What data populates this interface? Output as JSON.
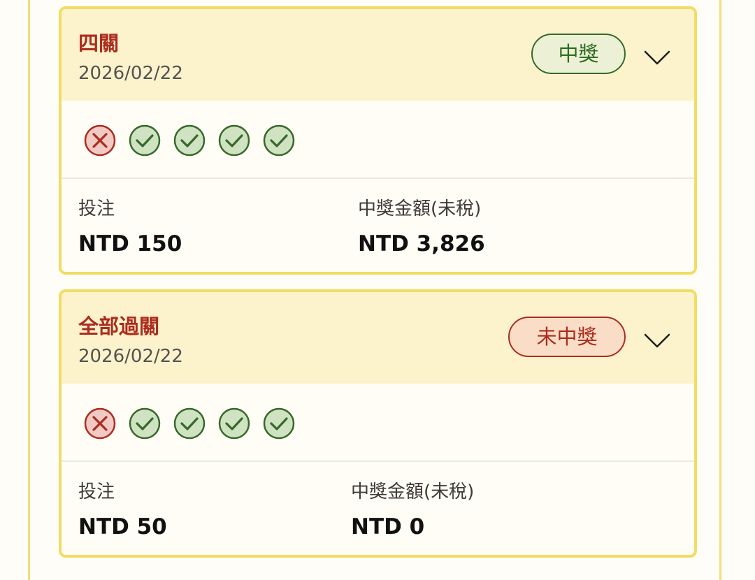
{
  "cards": [
    {
      "title": "四關",
      "date": "2026/02/22",
      "badge": "中獎",
      "badge_status": "win",
      "results": [
        "lose",
        "win",
        "win",
        "win",
        "win"
      ],
      "stake_label": "投注",
      "stake_value": "NTD 150",
      "payout_label": "中獎金額(未稅)",
      "payout_value": "NTD 3,826"
    },
    {
      "title": "全部過關",
      "date": "2026/02/22",
      "badge": "未中獎",
      "badge_status": "lose",
      "results": [
        "lose",
        "win",
        "win",
        "win",
        "win"
      ],
      "stake_label": "投注",
      "stake_value": "NTD 50",
      "payout_label": "中獎金額(未稅)",
      "payout_value": "NTD 0"
    }
  ],
  "icons": {
    "win": "check-circle-icon",
    "lose": "cross-circle-icon",
    "expand": "chevron-down-icon"
  },
  "colors": {
    "card_border": "#f2dc62",
    "header_bg": "#fcf3cd",
    "title": "#ac2c1e",
    "win_green": "#37692a",
    "win_fill": "#cfe3c2",
    "lose_red": "#ac2c1e",
    "lose_fill": "#f2cac5"
  }
}
